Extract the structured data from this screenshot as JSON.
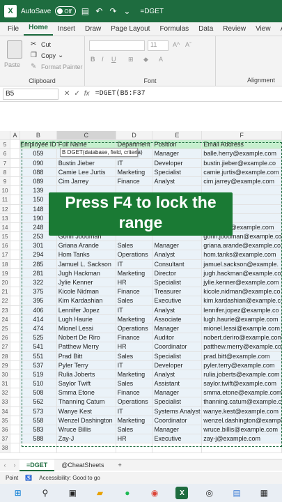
{
  "titlebar": {
    "autosave_label": "AutoSave",
    "toggle_state": "Off",
    "title": "=DGET"
  },
  "menu": [
    "File",
    "Home",
    "Insert",
    "Draw",
    "Page Layout",
    "Formulas",
    "Data",
    "Review",
    "View",
    "Automate"
  ],
  "active_menu": "Home",
  "ribbon": {
    "paste": "Paste",
    "cut": "Cut",
    "copy": "Copy",
    "format_painter": "Format Painter",
    "clipboard": "Clipboard",
    "font_size": "11",
    "font": "Font",
    "alignment": "Alignment"
  },
  "formula_bar": {
    "name_box": "B5",
    "formula": "=DGET(B5:F37"
  },
  "columns": [
    "A",
    "B",
    "C",
    "D",
    "E",
    "F"
  ],
  "header_row": {
    "num": "5",
    "cells": [
      "Employee ID",
      "Full Name",
      "Department",
      "Position",
      "Email Address"
    ]
  },
  "rows": [
    {
      "num": "6",
      "cells": [
        "059",
        "",
        "",
        "Manager",
        "balle.herry@example.com"
      ]
    },
    {
      "num": "7",
      "cells": [
        "090",
        "Bustin Jieber",
        "IT",
        "Developer",
        "bustin.jieber@example.co"
      ]
    },
    {
      "num": "8",
      "cells": [
        "088",
        "Camie Lee Jurtis",
        "Marketing",
        "Specialist",
        "camie.jurtis@example.com"
      ]
    },
    {
      "num": "9",
      "cells": [
        "089",
        "Cim Jarrey",
        "Finance",
        "Analyst",
        "cim.jarrey@example.com"
      ]
    },
    {
      "num": "10",
      "cells": [
        "139",
        "",
        "",
        "",
        ""
      ]
    },
    {
      "num": "11",
      "cells": [
        "150",
        "",
        "",
        "",
        ""
      ]
    },
    {
      "num": "12",
      "cells": [
        "148",
        "",
        "",
        "",
        ""
      ]
    },
    {
      "num": "13",
      "cells": [
        "190",
        "",
        "",
        "",
        ""
      ]
    },
    {
      "num": "14",
      "cells": [
        "248",
        "Gady Laga",
        "",
        "",
        "gady.laga@example.com"
      ]
    },
    {
      "num": "15",
      "cells": [
        "253",
        "Gohn Joodman",
        "",
        "",
        "gohn.joodman@example.co"
      ]
    },
    {
      "num": "16",
      "cells": [
        "301",
        "Griana Arande",
        "Sales",
        "Manager",
        "griana.arande@example.co"
      ]
    },
    {
      "num": "17",
      "cells": [
        "294",
        "Hom Tanks",
        "Operations",
        "Analyst",
        "hom.tanks@example.com"
      ]
    },
    {
      "num": "18",
      "cells": [
        "285",
        "Jamuel L. Sackson",
        "IT",
        "Consultant",
        "jamuel.sackson@example."
      ]
    },
    {
      "num": "19",
      "cells": [
        "281",
        "Jugh Hackman",
        "Marketing",
        "Director",
        "jugh.hackman@example.co"
      ]
    },
    {
      "num": "20",
      "cells": [
        "322",
        "Jylie Kenner",
        "HR",
        "Specialist",
        "jylie.kenner@example.com"
      ]
    },
    {
      "num": "21",
      "cells": [
        "375",
        "Kicole Nidman",
        "Finance",
        "Treasurer",
        "kicole.nidman@example.co"
      ]
    },
    {
      "num": "22",
      "cells": [
        "395",
        "Kim Kardashian",
        "Sales",
        "Executive",
        "kim.kardashian@example.c"
      ]
    },
    {
      "num": "23",
      "cells": [
        "406",
        "Lennifer Jopez",
        "IT",
        "Analyst",
        "lennifer.jopez@example.co"
      ]
    },
    {
      "num": "24",
      "cells": [
        "414",
        "Lugh Haurie",
        "Marketing",
        "Associate",
        "lugh.haurie@example.com"
      ]
    },
    {
      "num": "25",
      "cells": [
        "474",
        "Mionel Lessi",
        "Operations",
        "Manager",
        "mionel.lessi@example.com"
      ]
    },
    {
      "num": "26",
      "cells": [
        "525",
        "Nobert De Riro",
        "Finance",
        "Auditor",
        "nobert.deriro@example.com"
      ]
    },
    {
      "num": "27",
      "cells": [
        "541",
        "Patthew Merry",
        "HR",
        "Coordinator",
        "patthew.merry@example.co"
      ]
    },
    {
      "num": "28",
      "cells": [
        "551",
        "Prad Bitt",
        "Sales",
        "Specialist",
        "prad.bitt@example.com"
      ]
    },
    {
      "num": "29",
      "cells": [
        "537",
        "Pyler Terry",
        "IT",
        "Developer",
        "pyler.terry@example.com"
      ]
    },
    {
      "num": "30",
      "cells": [
        "519",
        "Rulia Joberts",
        "Marketing",
        "Analyst",
        "rulia.joberts@example.com"
      ]
    },
    {
      "num": "31",
      "cells": [
        "510",
        "Saylor Twift",
        "Sales",
        "Assistant",
        "saylor.twift@example.com"
      ]
    },
    {
      "num": "32",
      "cells": [
        "508",
        "Smma Etone",
        "Finance",
        "Manager",
        "smma.etone@example.com"
      ]
    },
    {
      "num": "33",
      "cells": [
        "562",
        "Thanning Catum",
        "Operations",
        "Specialist",
        "thanning.catum@example.c"
      ]
    },
    {
      "num": "34",
      "cells": [
        "573",
        "Wanye Kest",
        "IT",
        "Systems Analyst",
        "wanye.kest@example.com"
      ]
    },
    {
      "num": "35",
      "cells": [
        "558",
        "Wenzel Dashington",
        "Marketing",
        "Coordinator",
        "wenzel.dashington@exampl"
      ]
    },
    {
      "num": "36",
      "cells": [
        "583",
        "Wruce Billis",
        "Sales",
        "Manager",
        "wruce.billis@example.com"
      ]
    },
    {
      "num": "37",
      "cells": [
        "588",
        "Zay-J",
        "HR",
        "Executive",
        "zay-j@example.com"
      ]
    },
    {
      "num": "38",
      "cells": [
        "",
        "",
        "",
        "",
        ""
      ]
    }
  ],
  "tooltip": "DGET(database, field, criteria)",
  "tooltip_cell_prefix": "B",
  "caption": "Press F4 to lock the range",
  "sheet_tabs": [
    "=DGET",
    "@CheatSheets"
  ],
  "status": {
    "mode": "Point",
    "accessibility": "Accessibility: Good to go"
  },
  "taskbar_icons": [
    "windows-icon",
    "search-icon",
    "task-view-icon",
    "file-explorer-icon",
    "spotify-icon",
    "chrome-icon",
    "excel-icon",
    "obs-icon",
    "notepad-icon",
    "calculator-icon"
  ],
  "colors": {
    "brand": "#1e6c3f",
    "header_fill": "#c6efce",
    "caption_bg": "#1a7a34"
  }
}
